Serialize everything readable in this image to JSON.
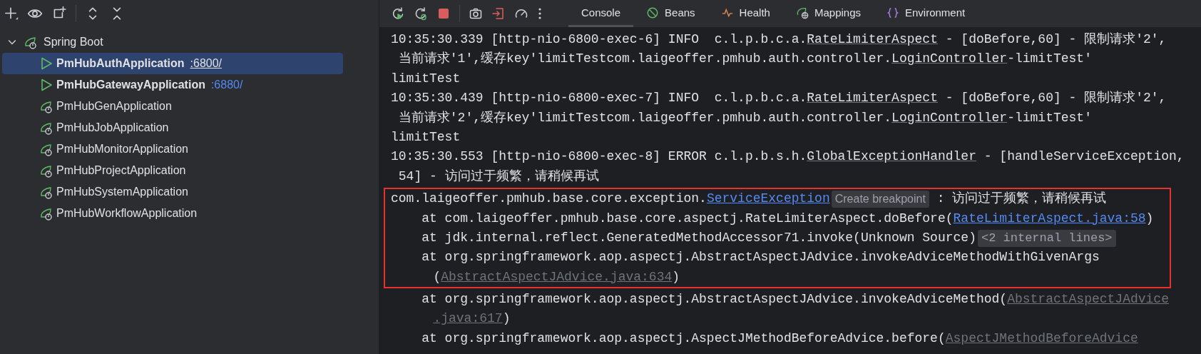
{
  "tree": {
    "label": "Spring Boot",
    "expanded": true,
    "children": [
      {
        "name": "PmHubAuthApplication",
        "port": ":6800/",
        "running": true,
        "selected": true
      },
      {
        "name": "PmHubGatewayApplication",
        "port": ":6880/",
        "running": true,
        "selected": false
      },
      {
        "name": "PmHubGenApplication",
        "running": false,
        "selected": false
      },
      {
        "name": "PmHubJobApplication",
        "running": false,
        "selected": false
      },
      {
        "name": "PmHubMonitorApplication",
        "running": false,
        "selected": false
      },
      {
        "name": "PmHubProjectApplication",
        "running": false,
        "selected": false
      },
      {
        "name": "PmHubSystemApplication",
        "running": false,
        "selected": false
      },
      {
        "name": "PmHubWorkflowApplication",
        "running": false,
        "selected": false
      }
    ]
  },
  "tabs": [
    {
      "label": "Console",
      "kind": "console",
      "selected": true
    },
    {
      "label": "Beans",
      "kind": "beans",
      "selected": false
    },
    {
      "label": "Health",
      "kind": "health",
      "selected": false
    },
    {
      "label": "Mappings",
      "kind": "mappings",
      "selected": false
    },
    {
      "label": "Environment",
      "kind": "environment",
      "selected": false
    }
  ],
  "console": {
    "blocks": [
      {
        "highlighted": false,
        "lines": [
          {
            "kind": "log",
            "segments": [
              {
                "kind": "text",
                "text": "10:35:30.339 [http-nio-6800-exec-6] INFO  c.l.p.b.c.a."
              },
              {
                "kind": "class_ref",
                "text": "RateLimiterAspect"
              },
              {
                "kind": "text",
                "text": " - [doBefore,60] - 限制请求'2',"
              }
            ]
          },
          {
            "kind": "continuation",
            "segments": [
              {
                "kind": "text",
                "text": "当前请求'1',缓存key'limitTestcom.laigeoffer.pmhub.auth.controller."
              },
              {
                "kind": "class_ref",
                "text": "LoginController"
              },
              {
                "kind": "text",
                "text": "-limitTest'"
              }
            ]
          },
          {
            "kind": "log",
            "segments": [
              {
                "kind": "text",
                "text": "limitTest"
              }
            ]
          },
          {
            "kind": "log",
            "segments": [
              {
                "kind": "text",
                "text": "10:35:30.439 [http-nio-6800-exec-7] INFO  c.l.p.b.c.a."
              },
              {
                "kind": "class_ref",
                "text": "RateLimiterAspect"
              },
              {
                "kind": "text",
                "text": " - [doBefore,60] - 限制请求'2',"
              }
            ]
          },
          {
            "kind": "continuation",
            "segments": [
              {
                "kind": "text",
                "text": "当前请求'2',缓存key'limitTestcom.laigeoffer.pmhub.auth.controller."
              },
              {
                "kind": "class_ref",
                "text": "LoginController"
              },
              {
                "kind": "text",
                "text": "-limitTest'"
              }
            ]
          },
          {
            "kind": "log",
            "segments": [
              {
                "kind": "text",
                "text": "limitTest"
              }
            ]
          },
          {
            "kind": "log",
            "segments": [
              {
                "kind": "text",
                "text": "10:35:30.553 [http-nio-6800-exec-8] ERROR c.l.p.b.s.h."
              },
              {
                "kind": "class_ref",
                "text": "GlobalExceptionHandler"
              },
              {
                "kind": "text",
                "text": " - [handleServiceException,"
              }
            ]
          },
          {
            "kind": "continuation",
            "segments": [
              {
                "kind": "text",
                "text": "54] - 访问过于频繁，请稍候再试"
              }
            ]
          }
        ]
      },
      {
        "highlighted": true,
        "lines": [
          {
            "kind": "log",
            "segments": [
              {
                "kind": "text",
                "text": "com.laigeoffer.pmhub.base.core.exception."
              },
              {
                "kind": "link",
                "text": "ServiceException"
              },
              {
                "kind": "chip",
                "text": "Create breakpoint"
              },
              {
                "kind": "text",
                "text": " : 访问过于频繁，请稍候再试"
              }
            ]
          },
          {
            "kind": "frame",
            "segments": [
              {
                "kind": "text",
                "text": "at com.laigeoffer.pmhub.base.core.aspectj.RateLimiterAspect.doBefore("
              },
              {
                "kind": "link",
                "text": "RateLimiterAspect.java:58"
              },
              {
                "kind": "text",
                "text": ")"
              }
            ]
          },
          {
            "kind": "frame",
            "segments": [
              {
                "kind": "text",
                "text": "at jdk.internal.reflect.GeneratedMethodAccessor71.invoke(Unknown Source)"
              },
              {
                "kind": "chip",
                "text": "<2 internal lines>"
              }
            ]
          },
          {
            "kind": "frame",
            "segments": [
              {
                "kind": "text",
                "text": "at org.springframework.aop.aspectj.AbstractAspectJAdvice.invokeAdviceMethodWithGivenArgs"
              }
            ]
          },
          {
            "kind": "frame_continuation",
            "segments": [
              {
                "kind": "text",
                "text": "("
              },
              {
                "kind": "dim_link",
                "text": "AbstractAspectJAdvice.java:634"
              },
              {
                "kind": "text",
                "text": ")"
              }
            ]
          }
        ]
      },
      {
        "highlighted": false,
        "lines": [
          {
            "kind": "frame",
            "segments": [
              {
                "kind": "text",
                "text": "at org.springframework.aop.aspectj.AbstractAspectJAdvice.invokeAdviceMethod("
              },
              {
                "kind": "dim_link",
                "text": "AbstractAspectJAdvice"
              }
            ]
          },
          {
            "kind": "frame_continuation",
            "segments": [
              {
                "kind": "dim_link",
                "text": ".java:617"
              },
              {
                "kind": "text",
                "text": ")"
              }
            ]
          },
          {
            "kind": "frame",
            "segments": [
              {
                "kind": "text",
                "text": "at org.springframework.aop.aspectj.AspectJMethodBeforeAdvice.before("
              },
              {
                "kind": "dim_link",
                "text": "AspectJMethodBeforeAdvice"
              }
            ]
          }
        ]
      }
    ]
  }
}
